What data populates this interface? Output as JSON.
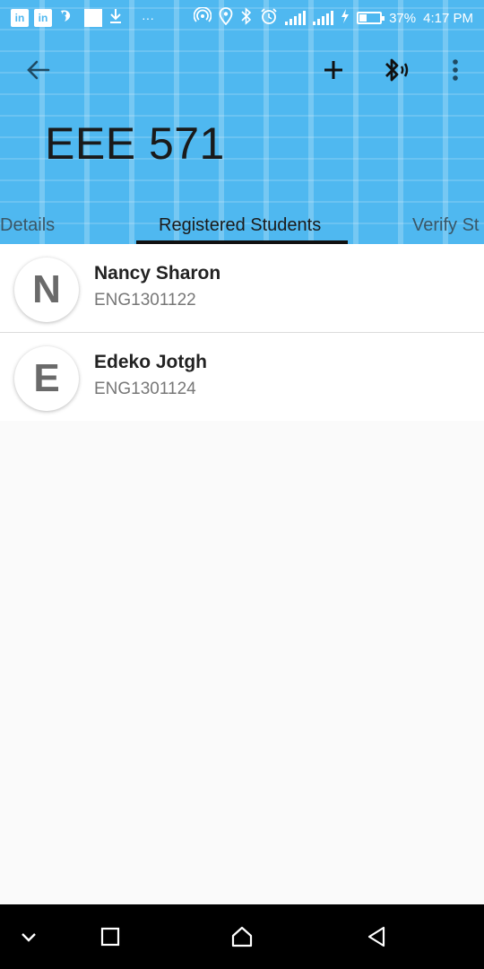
{
  "status_bar": {
    "left_icons": [
      "linkedin-icon",
      "linkedin-icon",
      "app-notification-icon",
      "white-square-icon",
      "download-icon",
      "more-notifications-icon"
    ],
    "linkedin_label": "in",
    "more_label": "···",
    "right_icons": [
      "hotspot-icon",
      "location-icon",
      "bluetooth-icon",
      "alarm-icon",
      "signal-icon",
      "signal-icon",
      "charging-icon",
      "battery-icon"
    ],
    "battery_percent": "37%",
    "battery_level": 0.37,
    "time": "4:17 PM"
  },
  "toolbar": {
    "back_icon": "arrow-left-icon",
    "add_icon": "plus-icon",
    "bluetooth_icon": "bluetooth-audio-icon",
    "menu_icon": "more-vert-icon"
  },
  "page": {
    "title": "EEE 571"
  },
  "tabs": [
    {
      "label": "Details",
      "active": false
    },
    {
      "label": "Registered Students",
      "active": true
    },
    {
      "label": "Verify St",
      "active": false
    }
  ],
  "students": [
    {
      "initial": "N",
      "name": "Nancy Sharon",
      "id": "ENG1301122"
    },
    {
      "initial": "E",
      "name": "Edeko Jotgh",
      "id": "ENG1301124"
    }
  ],
  "nav_bar": {
    "icons": [
      "chevron-down-icon",
      "recents-square-icon",
      "home-icon",
      "back-triangle-icon"
    ]
  },
  "colors": {
    "header_bg": "#4fb8f0",
    "tab_indicator": "#111111",
    "list_bg": "#ffffff",
    "page_bg": "#fafafa",
    "nav_bg": "#000000"
  }
}
